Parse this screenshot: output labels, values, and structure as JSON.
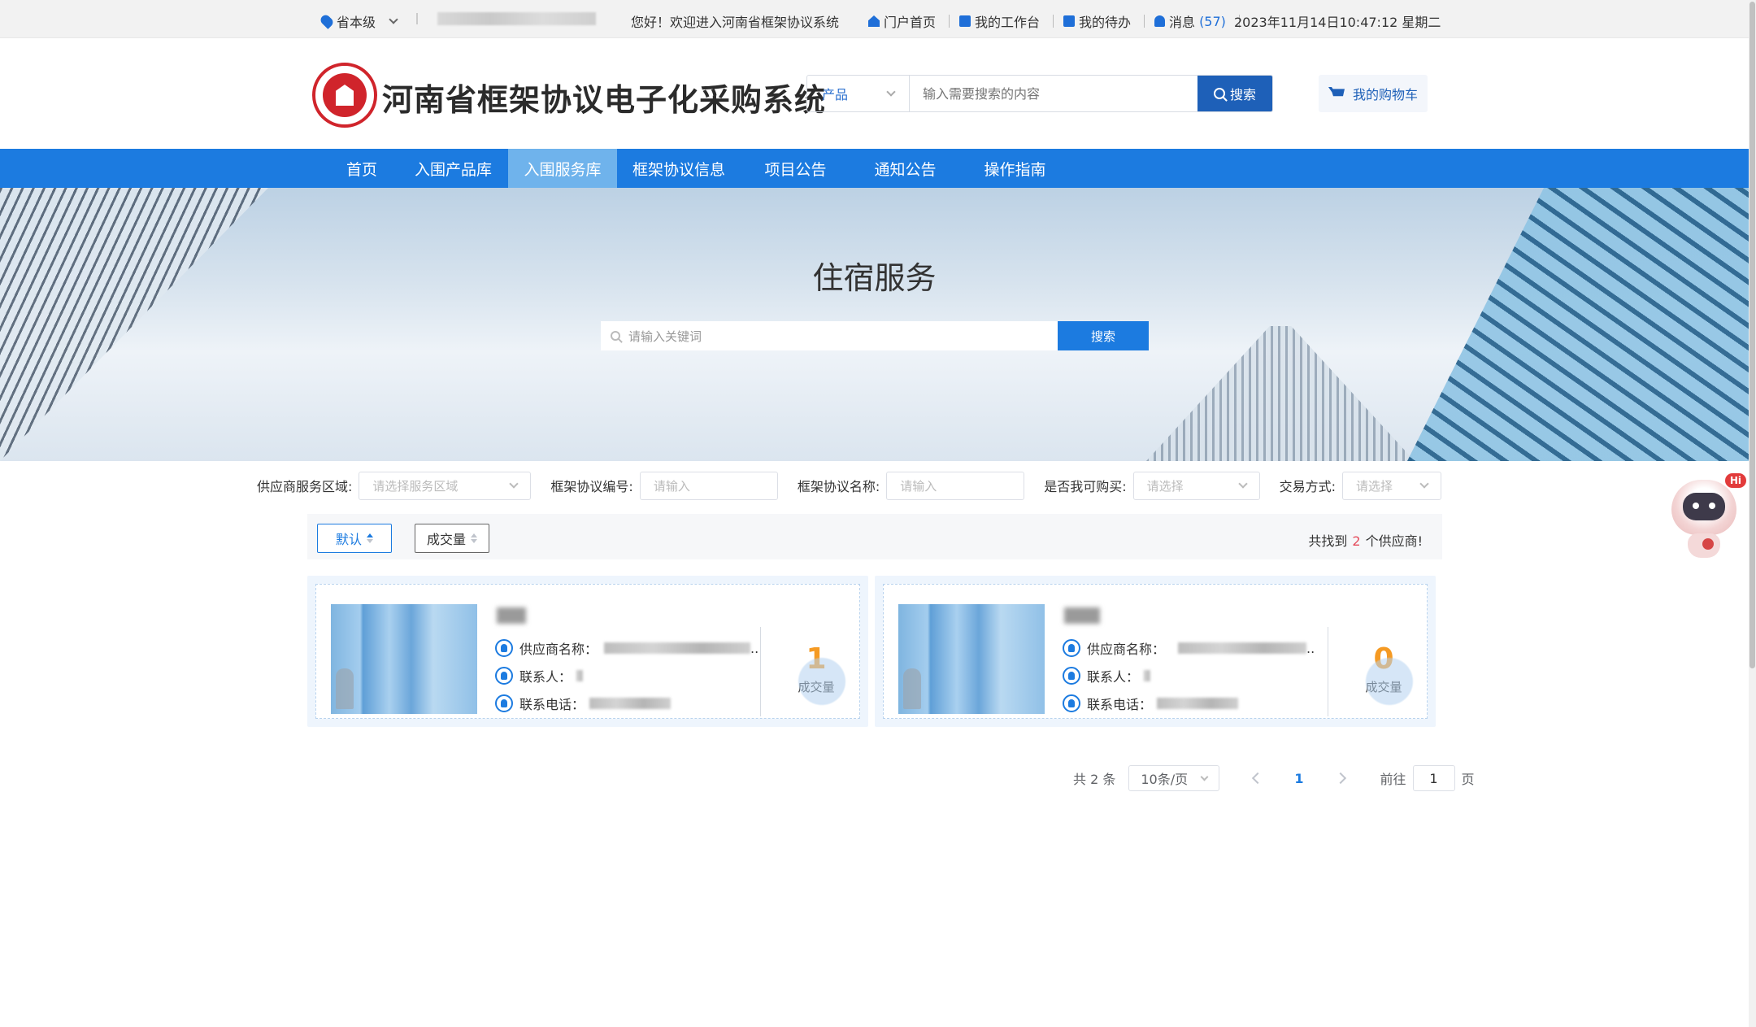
{
  "topbar": {
    "region": "省本级",
    "welcome": "您好！欢迎进入河南省框架协议系统",
    "links": [
      {
        "label": "门户首页",
        "icon": "home-icon"
      },
      {
        "label": "我的工作台",
        "icon": "workbench-icon"
      },
      {
        "label": "我的待办",
        "icon": "todo-icon"
      }
    ],
    "messages_label": "消息",
    "messages_count": "(57)",
    "datetime": "2023年11月14日10:47:12  星期二"
  },
  "header": {
    "site_title": "河南省框架协议电子化采购系统",
    "search": {
      "category": "产品",
      "placeholder": "输入需要搜索的内容",
      "button": "搜索"
    },
    "cart_label": "我的购物车"
  },
  "nav": {
    "items": [
      "首页",
      "入围产品库",
      "入围服务库",
      "框架协议信息",
      "项目公告",
      "通知公告",
      "操作指南"
    ],
    "active_index": 2
  },
  "banner": {
    "title": "住宿服务",
    "search_placeholder": "请输入关键词",
    "search_button": "搜索"
  },
  "filters": [
    {
      "label": "供应商服务区域:",
      "placeholder": "请选择服务区域",
      "type": "select"
    },
    {
      "label": "框架协议编号:",
      "placeholder": "请输入",
      "type": "input"
    },
    {
      "label": "框架协议名称:",
      "placeholder": "请输入",
      "type": "input"
    },
    {
      "label": "是否我可购买:",
      "placeholder": "请选择",
      "type": "select"
    },
    {
      "label": "交易方式:",
      "placeholder": "请选择",
      "type": "select"
    }
  ],
  "sort": {
    "default_label": "默认",
    "volume_label": "成交量",
    "found_prefix": "共找到",
    "found_count": "2",
    "found_suffix": "个供应商!"
  },
  "cards": [
    {
      "supplier_label": "供应商名称：",
      "contact_label": "联系人：",
      "phone_label": "联系电话：",
      "deals": "1",
      "deals_label": "成交量"
    },
    {
      "supplier_label": "供应商名称：",
      "contact_label": "联系人：",
      "phone_label": "联系电话：",
      "deals": "0",
      "deals_label": "成交量"
    }
  ],
  "pagination": {
    "total": "共 2 条",
    "page_size": "10条/页",
    "current": "1",
    "goto_label": "前往",
    "goto_value": "1",
    "page_suffix": "页"
  },
  "robot": {
    "badge": "Hi"
  },
  "colors": {
    "primary": "#1c7be0",
    "nav_active": "#6fb3ec",
    "accent_orange": "#f59a23",
    "brand_red": "#d0242b"
  }
}
